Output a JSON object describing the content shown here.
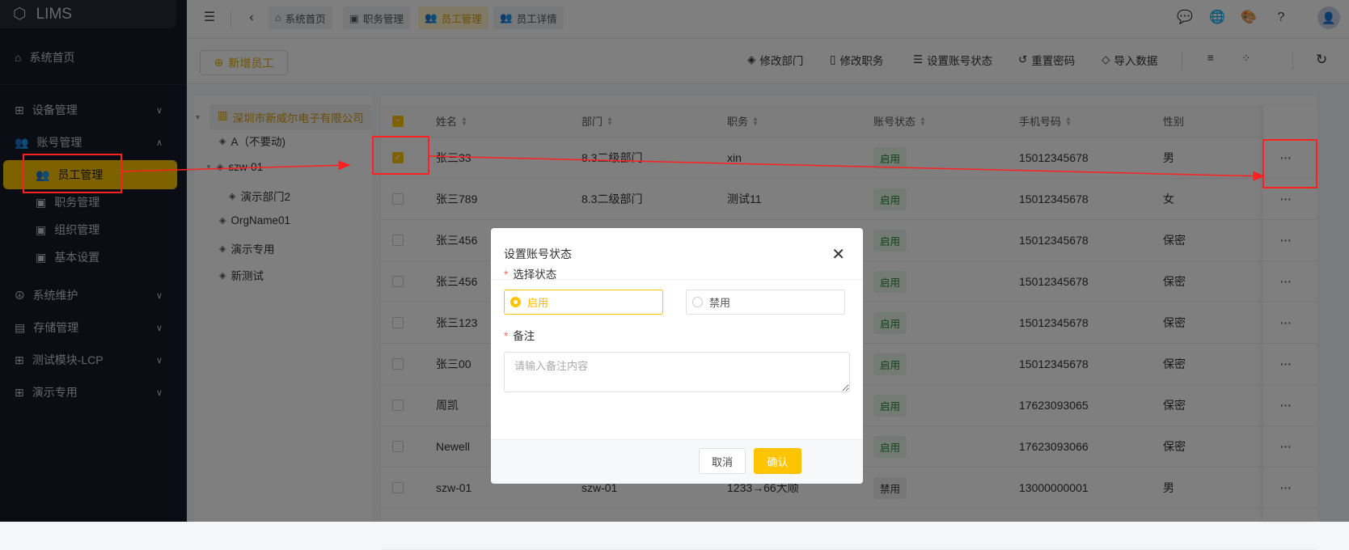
{
  "app": {
    "name": "LIMS"
  },
  "sidebar": {
    "items": [
      {
        "label": "系统首页",
        "icon": "home-icon"
      },
      {
        "label": "设备管理",
        "icon": "grid-icon"
      },
      {
        "label": "账号管理",
        "icon": "users-icon",
        "expanded": true,
        "children": [
          {
            "label": "员工管理",
            "icon": "users-icon",
            "active": true
          },
          {
            "label": "职务管理",
            "icon": "badge-icon"
          },
          {
            "label": "组织管理",
            "icon": "badge-icon"
          },
          {
            "label": "基本设置",
            "icon": "badge-icon"
          }
        ]
      },
      {
        "label": "系统维护",
        "icon": "peace-icon"
      },
      {
        "label": "存储管理",
        "icon": "storage-icon"
      },
      {
        "label": "测试模块-LCP",
        "icon": "grid-icon"
      },
      {
        "label": "演示专用",
        "icon": "grid-icon"
      }
    ]
  },
  "header": {
    "tabs": [
      {
        "label": "系统首页",
        "icon": "home-icon"
      },
      {
        "label": "职务管理",
        "icon": "badge-icon"
      },
      {
        "label": "员工管理",
        "icon": "users-icon",
        "active": true
      },
      {
        "label": "员工详情",
        "icon": "users-icon"
      }
    ],
    "icons": [
      "chat-icon",
      "globe-icon",
      "palette-icon",
      "help-icon",
      "avatar"
    ]
  },
  "toolbar": {
    "add_label": "新增员工",
    "actions": [
      "修改部门",
      "修改职务",
      "设置账号状态",
      "重置密码",
      "导入数据"
    ]
  },
  "tree": {
    "root": "深圳市新威尔电子有限公司",
    "nodes": [
      {
        "label": "A（不要动)",
        "level": 1
      },
      {
        "label": "szw-01",
        "level": 1,
        "expanded": true
      },
      {
        "label": "演示部门2",
        "level": 2
      },
      {
        "label": "OrgName01",
        "level": 1
      },
      {
        "label": "演示专用",
        "level": 1
      },
      {
        "label": "新测试",
        "level": 1
      }
    ]
  },
  "table": {
    "columns": [
      "姓名",
      "部门",
      "职务",
      "账号状态",
      "手机号码",
      "性别"
    ],
    "rows": [
      {
        "checked": true,
        "name": "张三33",
        "dept": "8.3二级部门",
        "title": "xin",
        "status": "启用",
        "phone": "15012345678",
        "gender": "男"
      },
      {
        "checked": false,
        "name": "张三789",
        "dept": "8.3二级部门",
        "title": "测试11",
        "status": "启用",
        "phone": "15012345678",
        "gender": "女"
      },
      {
        "checked": false,
        "name": "张三456",
        "dept": "",
        "title": "",
        "status": "启用",
        "phone": "15012345678",
        "gender": "保密"
      },
      {
        "checked": false,
        "name": "张三456",
        "dept": "",
        "title": "",
        "status": "启用",
        "phone": "15012345678",
        "gender": "保密"
      },
      {
        "checked": false,
        "name": "张三123",
        "dept": "",
        "title": "",
        "status": "启用",
        "phone": "15012345678",
        "gender": "保密"
      },
      {
        "checked": false,
        "name": "张三00",
        "dept": "",
        "title": "",
        "status": "启用",
        "phone": "15012345678",
        "gender": "保密"
      },
      {
        "checked": false,
        "name": "周凯",
        "dept": "",
        "title": "",
        "status": "启用",
        "phone": "17623093065",
        "gender": "保密"
      },
      {
        "checked": false,
        "name": "Newell",
        "dept": "",
        "title": "",
        "status": "启用",
        "phone": "17623093066",
        "gender": "保密"
      },
      {
        "checked": false,
        "name": "szw-01",
        "dept": "szw-01",
        "title": "1233→66大顺",
        "status": "禁用",
        "phone": "13000000001",
        "gender": "男"
      }
    ],
    "more_label": "···"
  },
  "dialog": {
    "title": "设置账号状态",
    "status_label": "选择状态",
    "options": [
      "启用",
      "禁用"
    ],
    "selected": "启用",
    "remark_label": "备注",
    "remark_placeholder": "请输入备注内容",
    "remark_value": "",
    "cancel": "取消",
    "confirm": "确认"
  },
  "colors": {
    "accent": "#ffc400",
    "enabled": "#1e8a2e",
    "annotation": "#ff2020"
  }
}
